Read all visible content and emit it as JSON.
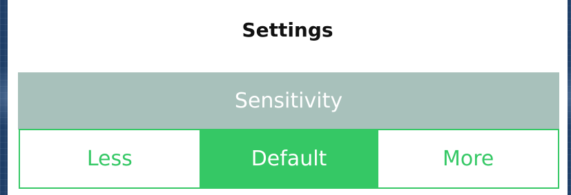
{
  "dialog": {
    "title": "Settings"
  },
  "sensitivity": {
    "label": "Sensitivity",
    "options": [
      {
        "label": "Less",
        "selected": false
      },
      {
        "label": "Default",
        "selected": true
      },
      {
        "label": "More",
        "selected": false
      }
    ]
  },
  "colors": {
    "accent": "#35c865",
    "section_header_bg": "#a8c1bb",
    "text_on_accent": "#ffffff",
    "title_text": "#111111",
    "background": "#1f3f68"
  }
}
